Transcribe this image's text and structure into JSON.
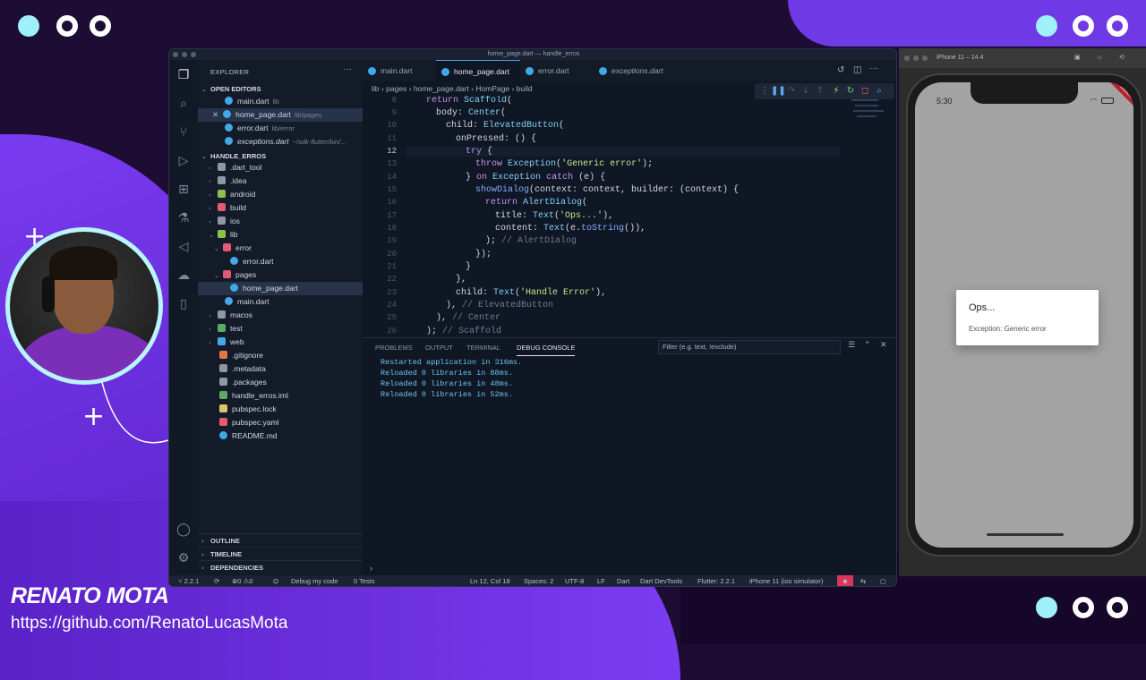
{
  "presenter": {
    "name": "RENATO MOTA",
    "link": "https://github.com/RenatoLucasMota"
  },
  "colors": {
    "accent_purple": "#6f3ae6",
    "accent_cyan": "#9ff0fb",
    "editor_bg": "#0f1624"
  },
  "window": {
    "title": "home_page.dart — handle_erros"
  },
  "explorer": {
    "title": "EXPLORER",
    "open_editors_label": "OPEN EDITORS",
    "open_editors": [
      {
        "name": "main.dart",
        "desc": "lib"
      },
      {
        "name": "home_page.dart",
        "desc": "lib/pages"
      },
      {
        "name": "error.dart",
        "desc": "lib/error"
      },
      {
        "name": "exceptions.dart",
        "desc": "~/sdk-flutter/bin/..."
      }
    ],
    "project_label": "HANDLE_ERROS",
    "tree": [
      ".dart_tool",
      ".idea",
      "android",
      "build",
      "ios",
      "lib",
      "error",
      "error.dart",
      "pages",
      "home_page.dart",
      "main.dart",
      "macos",
      "test",
      "web",
      ".gitignore",
      ".metadata",
      ".packages",
      "handle_erros.iml",
      "pubspec.lock",
      "pubspec.yaml",
      "README.md"
    ],
    "footer": [
      "OUTLINE",
      "TIMELINE",
      "DEPENDENCIES"
    ]
  },
  "tabs": [
    "main.dart",
    "home_page.dart",
    "error.dart",
    "exceptions.dart"
  ],
  "breadcrumb": [
    "lib",
    "pages",
    "home_page.dart",
    "HomPage",
    "build"
  ],
  "code_lines": [
    {
      "n": "8",
      "text": "return Scaffold("
    },
    {
      "n": "9",
      "text": "body: Center("
    },
    {
      "n": "10",
      "text": "child: ElevatedButton("
    },
    {
      "n": "11",
      "text": "onPressed: () {"
    },
    {
      "n": "12",
      "text": "try {"
    },
    {
      "n": "13",
      "text": "throw Exception('Generic error');"
    },
    {
      "n": "14",
      "text": "} on Exception catch (e) {"
    },
    {
      "n": "15",
      "text": "showDialog(context: context, builder: (context) {"
    },
    {
      "n": "16",
      "text": "return AlertDialog("
    },
    {
      "n": "17",
      "text": "title: Text('Ops...'),"
    },
    {
      "n": "18",
      "text": "content: Text(e.toString()),"
    },
    {
      "n": "19",
      "text": "); // AlertDialog"
    },
    {
      "n": "20",
      "text": "});"
    },
    {
      "n": "21",
      "text": "}"
    },
    {
      "n": "22",
      "text": "},"
    },
    {
      "n": "23",
      "text": "child: Text('Handle Error'),"
    },
    {
      "n": "24",
      "text": "), // ElevatedButton"
    },
    {
      "n": "25",
      "text": "), // Center"
    },
    {
      "n": "26",
      "text": "); // Scaffold"
    }
  ],
  "panel": {
    "tabs": [
      "PROBLEMS",
      "OUTPUT",
      "TERMINAL",
      "DEBUG CONSOLE"
    ],
    "filter_placeholder": "Filter (e.g. text, !exclude)",
    "output": [
      "Restarted application in 316ms.",
      "Reloaded 0 libraries in 88ms.",
      "Reloaded 0 libraries in 48ms.",
      "Reloaded 0 libraries in 52ms."
    ]
  },
  "statusbar": {
    "branch": "2.2.1",
    "errors": "0",
    "warnings": "0",
    "debug": "Debug my code",
    "tests": "0 Tests",
    "position": "Ln 12, Col 18",
    "spaces": "Spaces: 2",
    "encoding": "UTF-8",
    "eol": "LF",
    "lang": "Dart",
    "devtools": "Dart DevTools",
    "flutter": "Flutter: 2.2.1",
    "device": "iPhone 11 (ios simulator)"
  },
  "simulator": {
    "title": "iPhone 11 – 14.4",
    "time": "5:30",
    "dialog_title": "Ops...",
    "dialog_content": "Exception: Generic error",
    "banner": "DEBUG"
  }
}
